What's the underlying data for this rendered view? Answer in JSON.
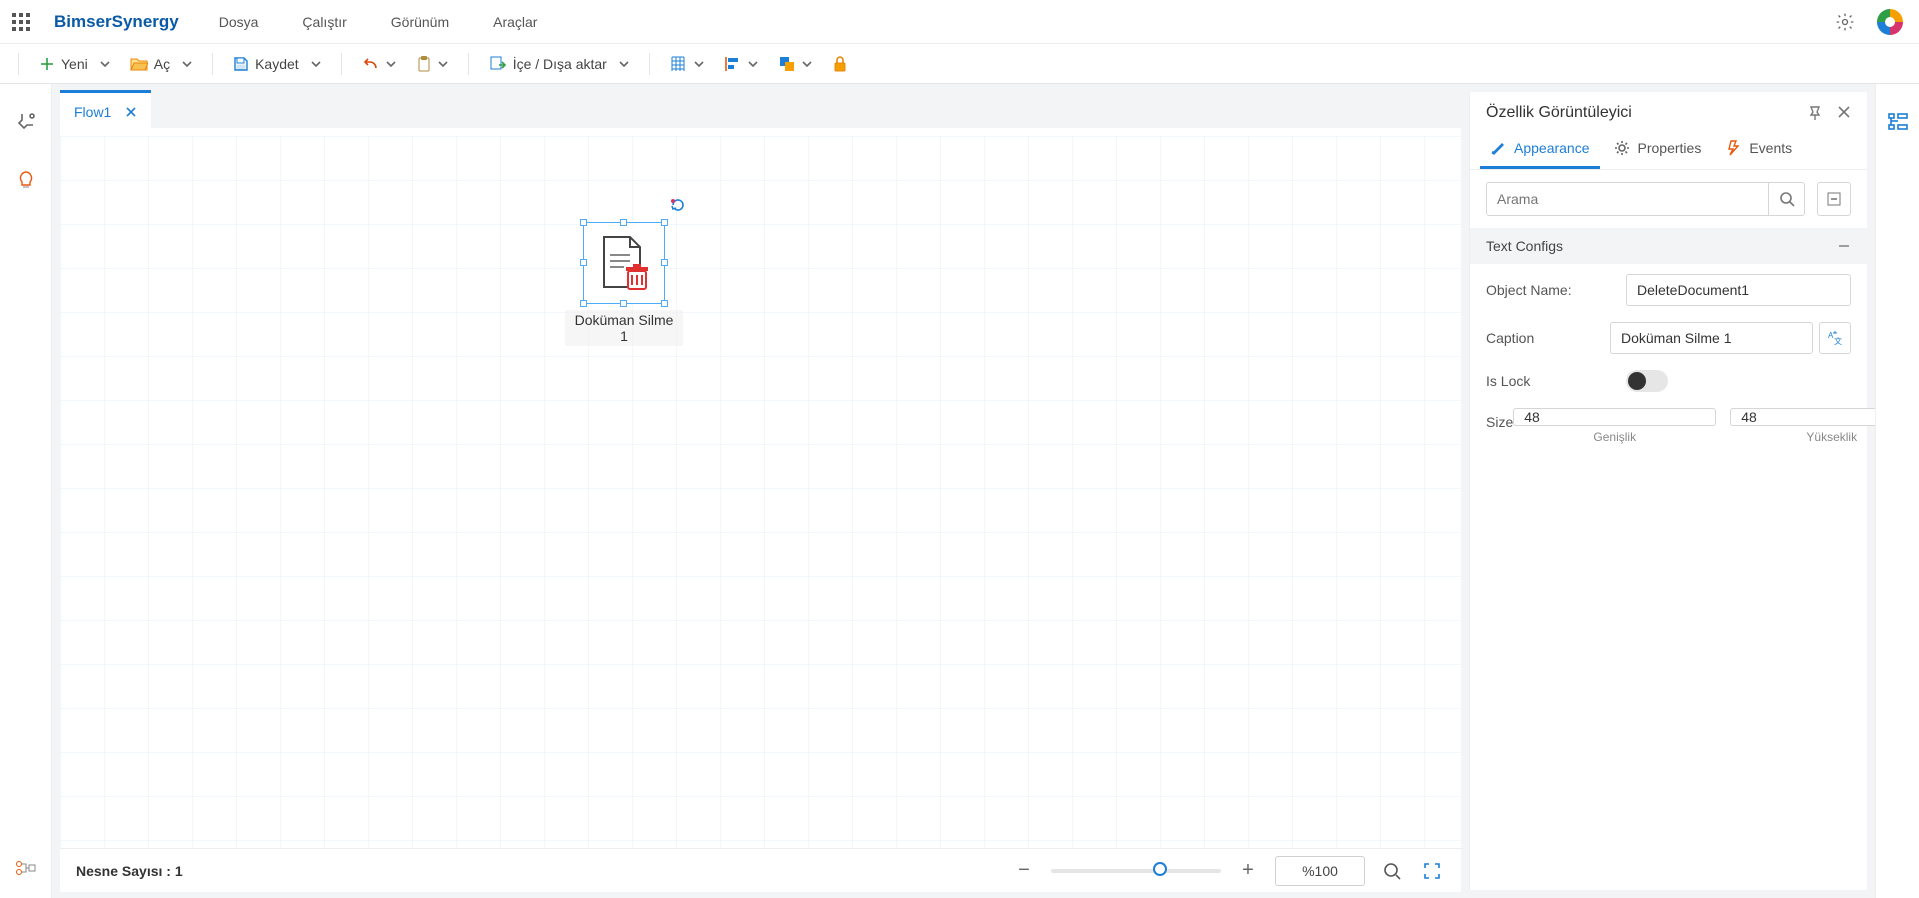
{
  "appbar": {
    "brand": "BimserSynergy",
    "menu": [
      "Dosya",
      "Çalıştır",
      "Görünüm",
      "Araçlar"
    ]
  },
  "toolbar": {
    "new": "Yeni",
    "open": "Aç",
    "save": "Kaydet",
    "import_export": "İçe / Dışa aktar"
  },
  "tabs": [
    {
      "label": "Flow1"
    }
  ],
  "canvas": {
    "node_caption": "Doküman Silme 1",
    "object_count_label": "Nesne Sayısı : 1",
    "zoom_text": "%100"
  },
  "panel": {
    "title": "Özellik Görüntüleyici",
    "tabs": {
      "appearance": "Appearance",
      "properties": "Properties",
      "events": "Events"
    },
    "search_placeholder": "Arama",
    "section_text_configs": "Text Configs",
    "labels": {
      "object_name": "Object Name:",
      "caption": "Caption",
      "is_lock": "Is Lock",
      "size": "Size",
      "width": "Genişlik",
      "height": "Yükseklik"
    },
    "values": {
      "object_name": "DeleteDocument1",
      "caption": "Doküman Silme 1",
      "width": "48",
      "height": "48"
    }
  }
}
